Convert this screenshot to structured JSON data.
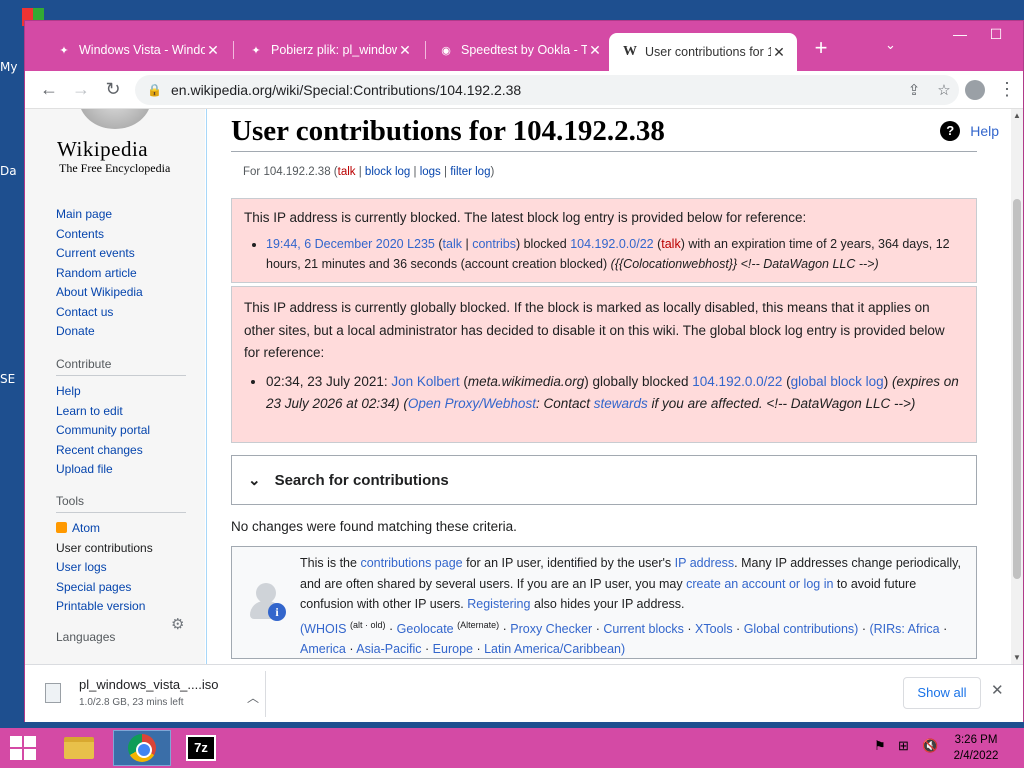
{
  "desktop": {
    "labels": [
      "My",
      "Da",
      "SE"
    ]
  },
  "window": {
    "tabs": [
      {
        "title": "Windows Vista - Windo",
        "icon": "wikipedia-favicon"
      },
      {
        "title": "Pobierz plik: pl_windows",
        "icon": "download-favicon"
      },
      {
        "title": "Speedtest by Ookla - Th",
        "icon": "speedtest-favicon"
      },
      {
        "title": "User contributions for 1",
        "icon": "wikipedia-favicon"
      }
    ],
    "url": "en.wikipedia.org/wiki/Special:Contributions/104.192.2.38"
  },
  "sidebar": {
    "logo_word": "Wikipedia",
    "logo_tagline": "The Free Encyclopedia",
    "nav": [
      "Main page",
      "Contents",
      "Current events",
      "Random article",
      "About Wikipedia",
      "Contact us",
      "Donate"
    ],
    "contribute_heading": "Contribute",
    "contribute": [
      "Help",
      "Learn to edit",
      "Community portal",
      "Recent changes",
      "Upload file"
    ],
    "tools_heading": "Tools",
    "tools": [
      "Atom",
      "User contributions",
      "User logs",
      "Special pages",
      "Printable version"
    ],
    "languages_heading": "Languages"
  },
  "content": {
    "title": "User contributions for 104.192.2.38",
    "help": "Help",
    "sub": {
      "prefix": "For 104.192.2.38 (",
      "talk": "talk",
      "sep1": " | ",
      "block_log": "block log",
      "sep2": " | ",
      "logs": "logs",
      "sep3": " | ",
      "filter_log": "filter log",
      "suffix": ")"
    },
    "local_block": {
      "intro": "This IP address is currently blocked. The latest block log entry is provided below for reference:",
      "time": "19:44, 6 December 2020",
      "user": "L235",
      "talk": "talk",
      "contribs": "contribs",
      "blocked": "blocked",
      "range": "104.192.0.0/22",
      "range_talk": "talk",
      "expiry_text": "with an expiration time of 2 years, 364 days, 12 hours, 21 minutes and 36 seconds (account creation blocked)",
      "reason": "({{Colocationwebhost}} <!-- DataWagon LLC -->)"
    },
    "global_block": {
      "intro": "This IP address is currently globally blocked. If the block is marked as locally disabled, this means that it applies on other sites, but a local administrator has decided to disable it on this wiki. The global block log entry is provided below for reference:",
      "time": "02:34, 23 July 2021:",
      "user": "Jon Kolbert",
      "site": "meta.wikimedia.org",
      "blocked": "globally blocked",
      "range": "104.192.0.0/22",
      "gbl_link": "global block log",
      "expires": "(expires on 23 July 2026 at 02:34)",
      "reason_link": "Open Proxy/Webhost",
      "reason_mid": ": Contact",
      "stewards": "stewards",
      "reason_end": "if you are affected. <!-- DataWagon LLC -->)"
    },
    "search_label": "Search for contributions",
    "no_changes": "No changes were found matching these criteria.",
    "info": {
      "t1": "This is the",
      "l_contrib": "contributions page",
      "t2": "for an IP user, identified by the user's",
      "l_ip": "IP address",
      "t3": ". Many IP addresses change periodically, and are often shared by several users. If you are an IP user, you may",
      "l_create": "create an account or log in",
      "t4": "to avoid future confusion with other IP users.",
      "l_reg": "Registering",
      "t5": "also hides your IP address.",
      "links": [
        {
          "label": "(WHOIS",
          "sup": "(alt · old)"
        },
        {
          "label": "Geolocate",
          "sup": "(Alternate)"
        },
        {
          "label": "Proxy Checker",
          "sup": ""
        },
        {
          "label": "Current blocks",
          "sup": ""
        },
        {
          "label": "XTools",
          "sup": ""
        },
        {
          "label": "Global contributions)",
          "sup": ""
        }
      ],
      "rirs": [
        "(RIRs: Africa",
        "America",
        "Asia-Pacific",
        "Europe",
        "Latin America/Caribbean)"
      ]
    }
  },
  "download": {
    "filename": "pl_windows_vista_....iso",
    "progress": "1.0/2.8 GB, 23 mins left",
    "show_all": "Show all"
  },
  "taskbar": {
    "time": "3:26 PM",
    "date": "2/4/2022"
  },
  "colors": {
    "accent": "#d44aa5",
    "block_bg": "#ffdbdb",
    "link": "#3366cc"
  }
}
